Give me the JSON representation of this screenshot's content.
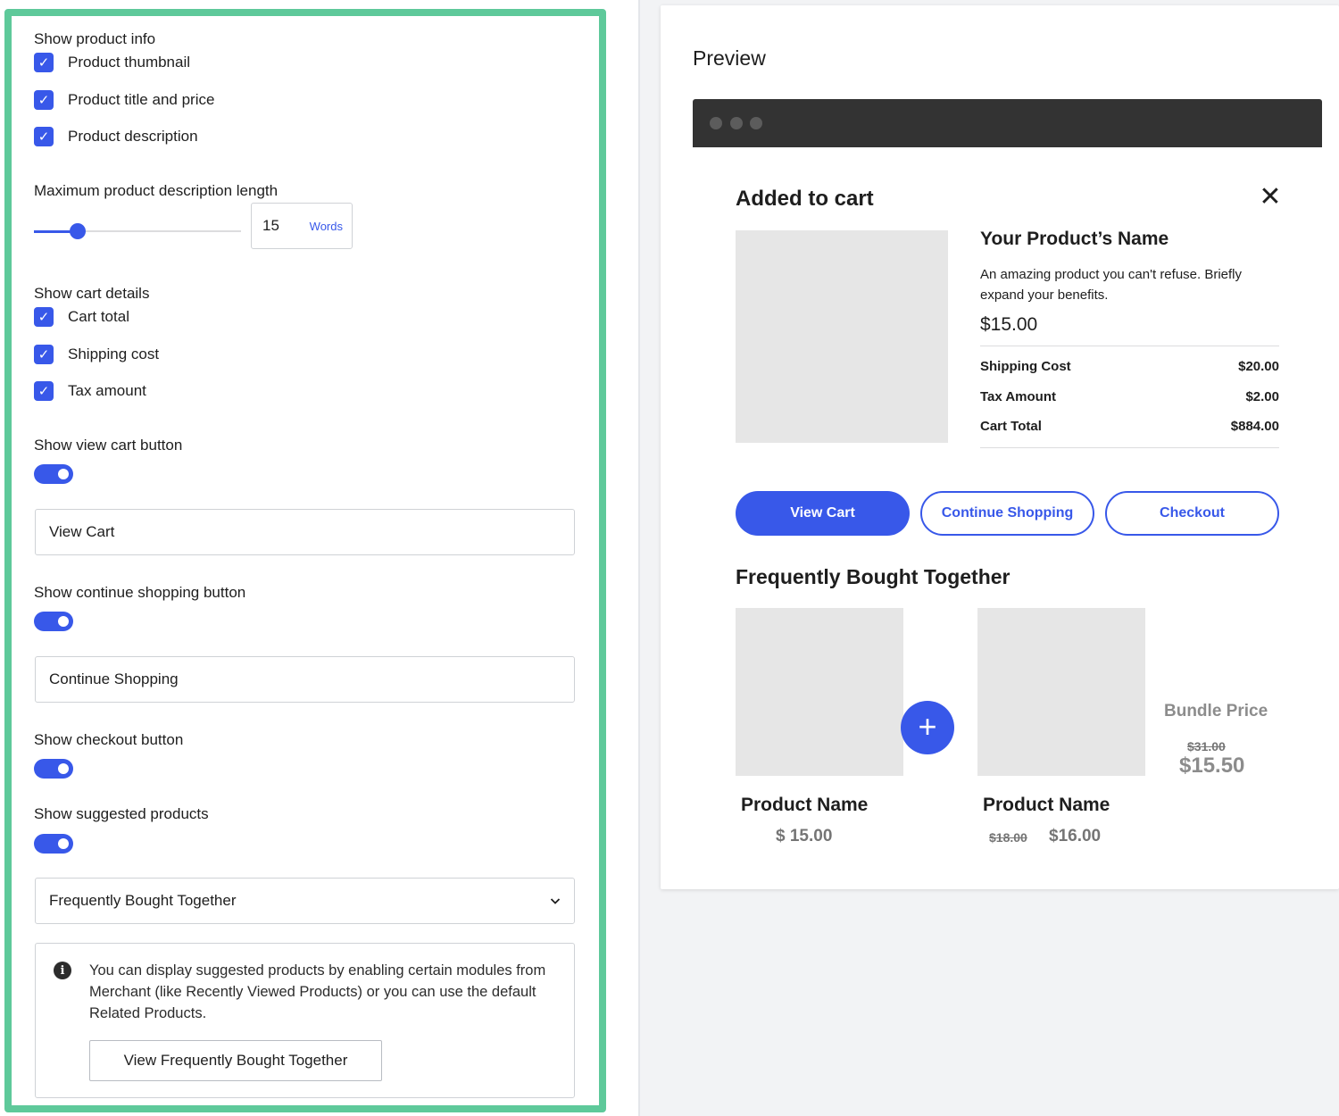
{
  "settings": {
    "product_info": {
      "heading": "Show product info",
      "items": [
        {
          "label": "Product thumbnail",
          "checked": true
        },
        {
          "label": "Product title and price",
          "checked": true
        },
        {
          "label": "Product description",
          "checked": true
        }
      ]
    },
    "description_length": {
      "heading": "Maximum product description length",
      "value": "15",
      "unit": "Words",
      "slider_fraction": 0.21
    },
    "cart_details": {
      "heading": "Show cart details",
      "items": [
        {
          "label": "Cart total",
          "checked": true
        },
        {
          "label": "Shipping cost",
          "checked": true
        },
        {
          "label": "Tax amount",
          "checked": true
        }
      ]
    },
    "view_cart": {
      "heading": "Show view cart button",
      "enabled": true,
      "value": "View Cart"
    },
    "continue_shopping": {
      "heading": "Show continue shopping button",
      "enabled": true,
      "value": "Continue Shopping"
    },
    "checkout": {
      "heading": "Show checkout button",
      "enabled": true
    },
    "suggested": {
      "heading": "Show suggested products",
      "enabled": true,
      "selected": "Frequently Bought Together"
    },
    "notice": {
      "icon": "info-icon",
      "text": "You can display suggested products by enabling certain modules from Merchant (like Recently Viewed Products) or you can use the default Related Products.",
      "button_label": "View Frequently Bought Together"
    }
  },
  "preview": {
    "title": "Preview",
    "modal": {
      "title": "Added to cart",
      "close_icon": "close-icon",
      "product_name": "Your Product’s Name",
      "product_description": "An amazing product you can't refuse. Briefly expand your benefits.",
      "product_price": "$15.00",
      "summary": [
        {
          "label": "Shipping Cost",
          "value": "$20.00"
        },
        {
          "label": "Tax Amount",
          "value": "$2.00"
        },
        {
          "label": "Cart Total",
          "value": "$884.00"
        }
      ],
      "buttons": {
        "view_cart": "View Cart",
        "continue_shopping": "Continue Shopping",
        "checkout": "Checkout"
      },
      "fbt": {
        "title": "Frequently Bought Together",
        "plus_icon": "plus-icon",
        "products": [
          {
            "name": "Product Name",
            "price": "$ 15.00",
            "old_price": ""
          },
          {
            "name": "Product Name",
            "price": "$16.00",
            "old_price": "$18.00"
          }
        ],
        "bundle_label": "Bundle Price",
        "bundle_old_price": "$31.00",
        "bundle_price": "$15.50"
      }
    }
  },
  "colors": {
    "accent": "#3858e9",
    "highlight_border": "#5ec99a",
    "browser_bar": "#333333",
    "placeholder": "#e6e6e6"
  }
}
